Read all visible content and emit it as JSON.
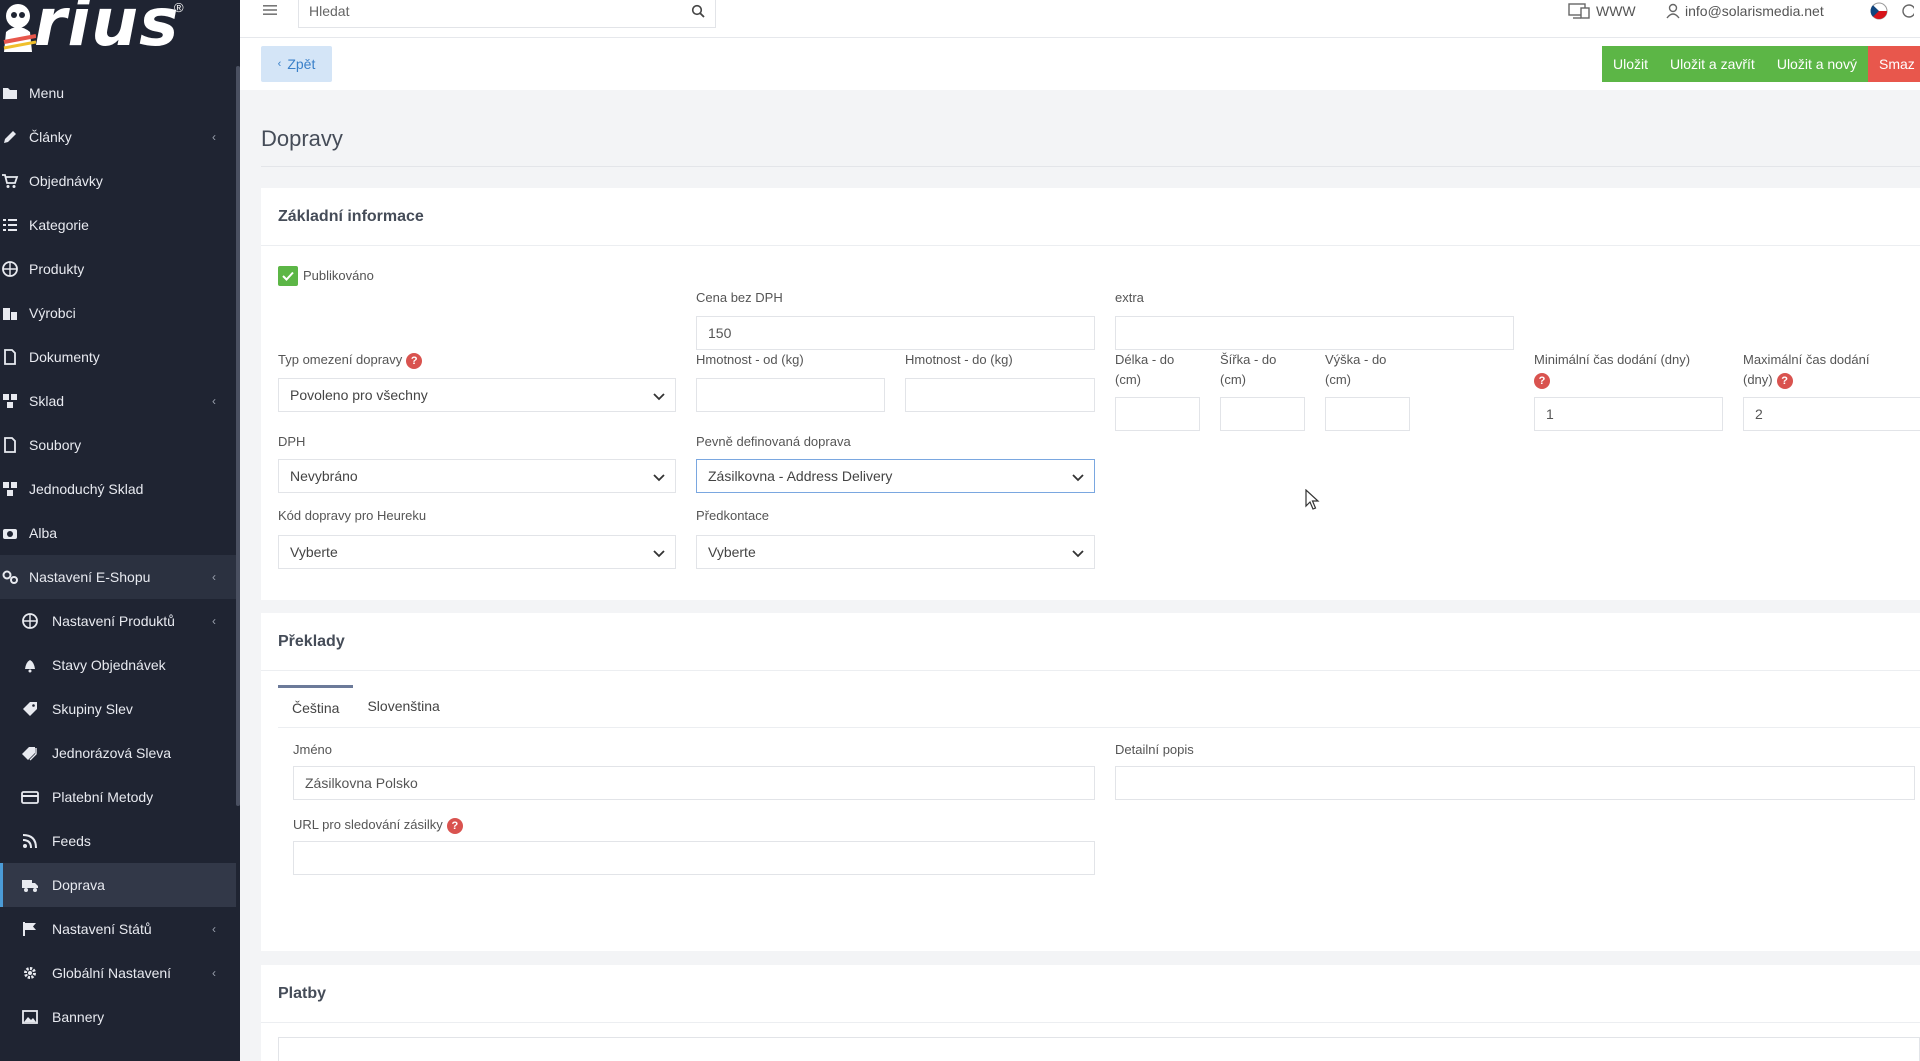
{
  "sidebar": {
    "logo_text": "rius",
    "logo_mark": "®",
    "items": [
      {
        "label": "Menu",
        "icon": "folder-icon",
        "chevron": false,
        "sub": false
      },
      {
        "label": "Články",
        "icon": "pencil-icon",
        "chevron": true,
        "sub": false
      },
      {
        "label": "Objednávky",
        "icon": "cart-icon",
        "chevron": false,
        "sub": false
      },
      {
        "label": "Kategorie",
        "icon": "list-icon",
        "chevron": false,
        "sub": false
      },
      {
        "label": "Produkty",
        "icon": "ball-icon",
        "chevron": false,
        "sub": false
      },
      {
        "label": "Výrobci",
        "icon": "building-icon",
        "chevron": false,
        "sub": false
      },
      {
        "label": "Dokumenty",
        "icon": "document-icon",
        "chevron": false,
        "sub": false
      },
      {
        "label": "Sklad",
        "icon": "boxes-icon",
        "chevron": true,
        "sub": false
      },
      {
        "label": "Soubory",
        "icon": "file-icon",
        "chevron": false,
        "sub": false
      },
      {
        "label": "Jednoduchý Sklad",
        "icon": "boxes-icon",
        "chevron": false,
        "sub": false
      },
      {
        "label": "Alba",
        "icon": "camera-icon",
        "chevron": false,
        "sub": false
      },
      {
        "label": "Nastavení E-Shopu",
        "icon": "cogs-icon",
        "chevron": true,
        "sub": false,
        "state": "open"
      },
      {
        "label": "Nastavení Produktů",
        "icon": "ball-icon",
        "chevron": true,
        "sub": true
      },
      {
        "label": "Stavy Objednávek",
        "icon": "bell-icon",
        "chevron": false,
        "sub": true
      },
      {
        "label": "Skupiny Slev",
        "icon": "tag-icon",
        "chevron": false,
        "sub": true
      },
      {
        "label": "Jednorázová Sleva",
        "icon": "tags-icon",
        "chevron": false,
        "sub": true
      },
      {
        "label": "Platební Metody",
        "icon": "credit-card-icon",
        "chevron": false,
        "sub": true
      },
      {
        "label": "Feeds",
        "icon": "rss-icon",
        "chevron": false,
        "sub": true
      },
      {
        "label": "Doprava",
        "icon": "truck-icon",
        "chevron": false,
        "sub": true,
        "state": "active"
      },
      {
        "label": "Nastavení Států",
        "icon": "flag-icon",
        "chevron": true,
        "sub": true
      },
      {
        "label": "Globální Nastavení",
        "icon": "gear-icon",
        "chevron": true,
        "sub": true
      },
      {
        "label": "Bannery",
        "icon": "image-icon",
        "chevron": false,
        "sub": true
      }
    ]
  },
  "topbar": {
    "search_placeholder": "Hledat",
    "www_label": "WWW",
    "user_email": "info@solarismedia.net"
  },
  "actions": {
    "back_label": "Zpět",
    "save": "Uložit",
    "save_close": "Uložit a zavřít",
    "save_new": "Uložit a nový",
    "delete": "Smaz"
  },
  "page": {
    "title": "Dopravy"
  },
  "basic": {
    "header": "Základní informace",
    "published_label": "Publikováno",
    "published": true,
    "price_label": "Cena bez DPH",
    "price_value": "150",
    "extra_label": "extra",
    "extra_value": "",
    "restriction_label": "Typ omezení dopravy",
    "restriction_value": "Povoleno pro všechny",
    "weight_from_label": "Hmotnost - od (kg)",
    "weight_to_label": "Hmotnost - do (kg)",
    "length_label_1": "Délka - do",
    "length_label_2": "(cm)",
    "width_label_1": "Šířka - do",
    "width_label_2": "(cm)",
    "height_label_1": "Výška - do",
    "height_label_2": "(cm)",
    "min_time_label": "Minimální čas dodání (dny)",
    "min_time_value": "1",
    "max_time_label_1": "Maximální čas dodání",
    "max_time_label_2": "(dny)",
    "max_time_value": "2",
    "vat_label": "DPH",
    "vat_value": "Nevybráno",
    "fixed_label": "Pevně definovaná doprava",
    "fixed_value": "Zásilkovna - Address Delivery",
    "heureka_label": "Kód dopravy pro Heureku",
    "heureka_value": "Vyberte",
    "precontact_label": "Předkontace",
    "precontact_value": "Vyberte",
    "help_glyph": "?"
  },
  "translations": {
    "header": "Překlady",
    "tabs": [
      "Čeština",
      "Slovenština"
    ],
    "name_label": "Jméno",
    "name_value": "Zásilkovna Polsko",
    "detail_label": "Detailní popis",
    "url_label": "URL pro sledování zásilky"
  },
  "payments": {
    "header": "Platby"
  },
  "colors": {
    "sidebar_bg": "#1f2432",
    "accent_green": "#5cb646",
    "accent_red": "#e8574c",
    "back_button_bg": "#d4e5f7",
    "help_icon": "#d9534f"
  }
}
